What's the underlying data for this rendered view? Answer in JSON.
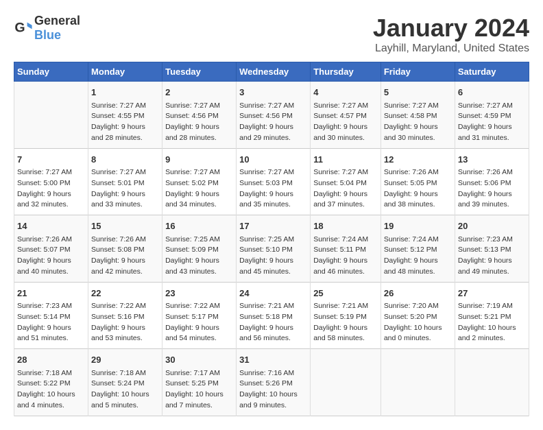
{
  "header": {
    "logo_text_general": "General",
    "logo_text_blue": "Blue",
    "month_title": "January 2024",
    "location": "Layhill, Maryland, United States"
  },
  "days_of_week": [
    "Sunday",
    "Monday",
    "Tuesday",
    "Wednesday",
    "Thursday",
    "Friday",
    "Saturday"
  ],
  "weeks": [
    [
      {
        "day": "",
        "info": ""
      },
      {
        "day": "1",
        "info": "Sunrise: 7:27 AM\nSunset: 4:55 PM\nDaylight: 9 hours\nand 28 minutes."
      },
      {
        "day": "2",
        "info": "Sunrise: 7:27 AM\nSunset: 4:56 PM\nDaylight: 9 hours\nand 28 minutes."
      },
      {
        "day": "3",
        "info": "Sunrise: 7:27 AM\nSunset: 4:56 PM\nDaylight: 9 hours\nand 29 minutes."
      },
      {
        "day": "4",
        "info": "Sunrise: 7:27 AM\nSunset: 4:57 PM\nDaylight: 9 hours\nand 30 minutes."
      },
      {
        "day": "5",
        "info": "Sunrise: 7:27 AM\nSunset: 4:58 PM\nDaylight: 9 hours\nand 30 minutes."
      },
      {
        "day": "6",
        "info": "Sunrise: 7:27 AM\nSunset: 4:59 PM\nDaylight: 9 hours\nand 31 minutes."
      }
    ],
    [
      {
        "day": "7",
        "info": "Sunrise: 7:27 AM\nSunset: 5:00 PM\nDaylight: 9 hours\nand 32 minutes."
      },
      {
        "day": "8",
        "info": "Sunrise: 7:27 AM\nSunset: 5:01 PM\nDaylight: 9 hours\nand 33 minutes."
      },
      {
        "day": "9",
        "info": "Sunrise: 7:27 AM\nSunset: 5:02 PM\nDaylight: 9 hours\nand 34 minutes."
      },
      {
        "day": "10",
        "info": "Sunrise: 7:27 AM\nSunset: 5:03 PM\nDaylight: 9 hours\nand 35 minutes."
      },
      {
        "day": "11",
        "info": "Sunrise: 7:27 AM\nSunset: 5:04 PM\nDaylight: 9 hours\nand 37 minutes."
      },
      {
        "day": "12",
        "info": "Sunrise: 7:26 AM\nSunset: 5:05 PM\nDaylight: 9 hours\nand 38 minutes."
      },
      {
        "day": "13",
        "info": "Sunrise: 7:26 AM\nSunset: 5:06 PM\nDaylight: 9 hours\nand 39 minutes."
      }
    ],
    [
      {
        "day": "14",
        "info": "Sunrise: 7:26 AM\nSunset: 5:07 PM\nDaylight: 9 hours\nand 40 minutes."
      },
      {
        "day": "15",
        "info": "Sunrise: 7:26 AM\nSunset: 5:08 PM\nDaylight: 9 hours\nand 42 minutes."
      },
      {
        "day": "16",
        "info": "Sunrise: 7:25 AM\nSunset: 5:09 PM\nDaylight: 9 hours\nand 43 minutes."
      },
      {
        "day": "17",
        "info": "Sunrise: 7:25 AM\nSunset: 5:10 PM\nDaylight: 9 hours\nand 45 minutes."
      },
      {
        "day": "18",
        "info": "Sunrise: 7:24 AM\nSunset: 5:11 PM\nDaylight: 9 hours\nand 46 minutes."
      },
      {
        "day": "19",
        "info": "Sunrise: 7:24 AM\nSunset: 5:12 PM\nDaylight: 9 hours\nand 48 minutes."
      },
      {
        "day": "20",
        "info": "Sunrise: 7:23 AM\nSunset: 5:13 PM\nDaylight: 9 hours\nand 49 minutes."
      }
    ],
    [
      {
        "day": "21",
        "info": "Sunrise: 7:23 AM\nSunset: 5:14 PM\nDaylight: 9 hours\nand 51 minutes."
      },
      {
        "day": "22",
        "info": "Sunrise: 7:22 AM\nSunset: 5:16 PM\nDaylight: 9 hours\nand 53 minutes."
      },
      {
        "day": "23",
        "info": "Sunrise: 7:22 AM\nSunset: 5:17 PM\nDaylight: 9 hours\nand 54 minutes."
      },
      {
        "day": "24",
        "info": "Sunrise: 7:21 AM\nSunset: 5:18 PM\nDaylight: 9 hours\nand 56 minutes."
      },
      {
        "day": "25",
        "info": "Sunrise: 7:21 AM\nSunset: 5:19 PM\nDaylight: 9 hours\nand 58 minutes."
      },
      {
        "day": "26",
        "info": "Sunrise: 7:20 AM\nSunset: 5:20 PM\nDaylight: 10 hours\nand 0 minutes."
      },
      {
        "day": "27",
        "info": "Sunrise: 7:19 AM\nSunset: 5:21 PM\nDaylight: 10 hours\nand 2 minutes."
      }
    ],
    [
      {
        "day": "28",
        "info": "Sunrise: 7:18 AM\nSunset: 5:22 PM\nDaylight: 10 hours\nand 4 minutes."
      },
      {
        "day": "29",
        "info": "Sunrise: 7:18 AM\nSunset: 5:24 PM\nDaylight: 10 hours\nand 5 minutes."
      },
      {
        "day": "30",
        "info": "Sunrise: 7:17 AM\nSunset: 5:25 PM\nDaylight: 10 hours\nand 7 minutes."
      },
      {
        "day": "31",
        "info": "Sunrise: 7:16 AM\nSunset: 5:26 PM\nDaylight: 10 hours\nand 9 minutes."
      },
      {
        "day": "",
        "info": ""
      },
      {
        "day": "",
        "info": ""
      },
      {
        "day": "",
        "info": ""
      }
    ]
  ]
}
